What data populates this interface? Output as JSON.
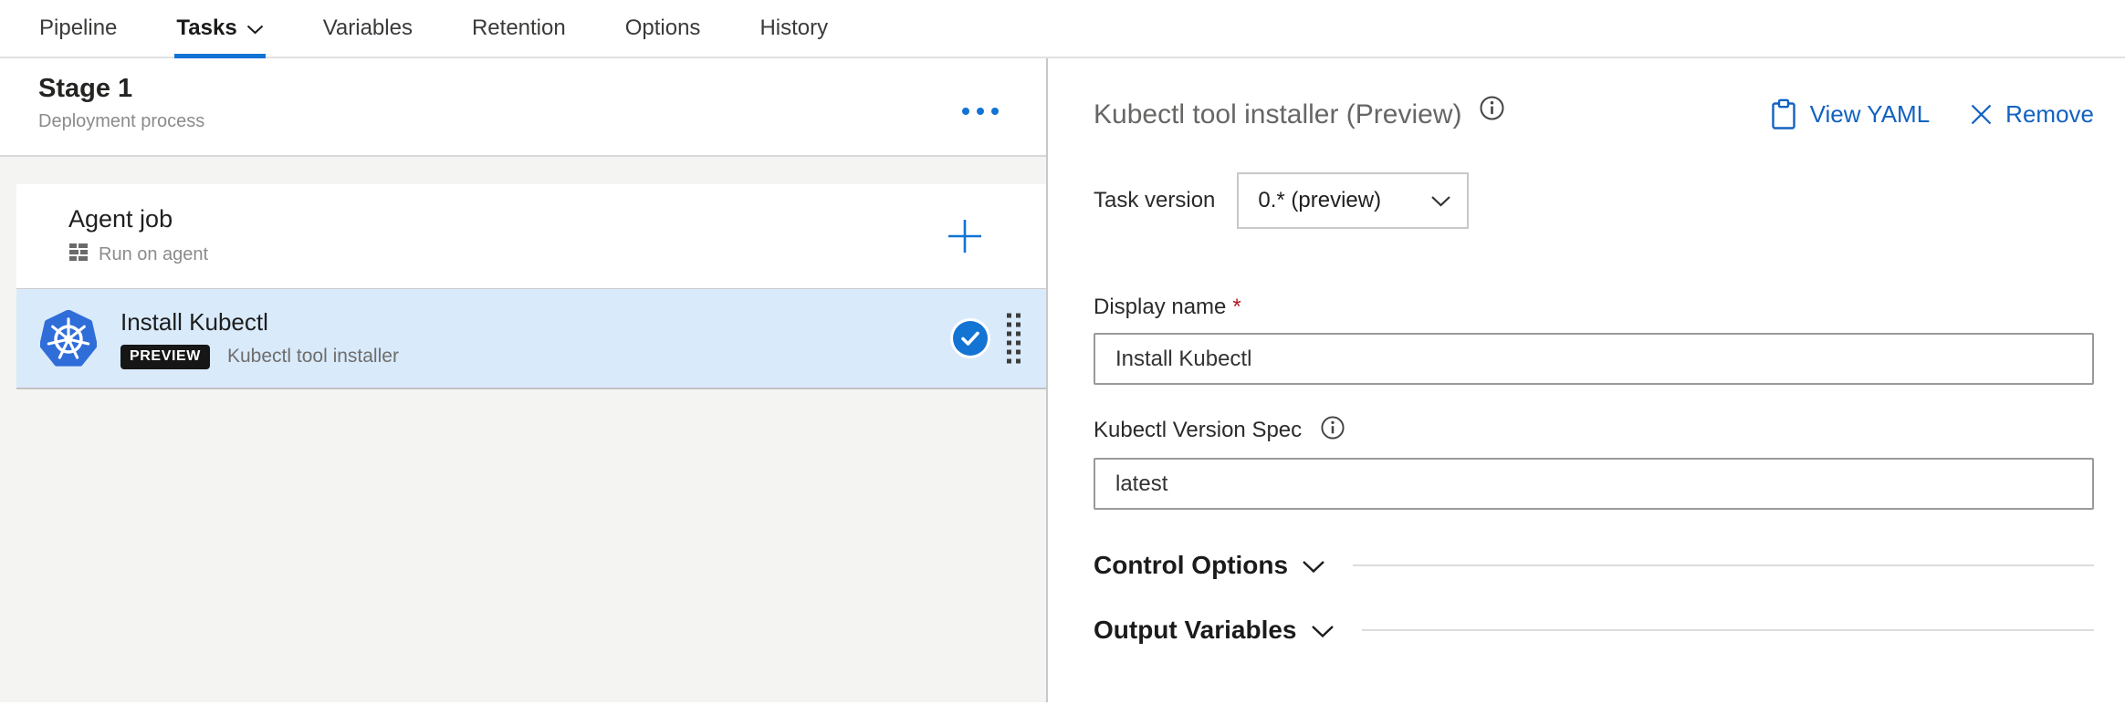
{
  "nav": {
    "items": [
      {
        "label": "Pipeline"
      },
      {
        "label": "Tasks",
        "selected": true
      },
      {
        "label": "Variables"
      },
      {
        "label": "Retention"
      },
      {
        "label": "Options"
      },
      {
        "label": "History"
      }
    ]
  },
  "stage_panel": {
    "title": "Stage 1",
    "subtitle": "Deployment process",
    "agent_job": {
      "title": "Agent job",
      "subtitle": "Run on agent"
    },
    "task": {
      "title": "Install Kubectl",
      "badge": "PREVIEW",
      "subtitle": "Kubectl tool installer"
    }
  },
  "detail_panel": {
    "title": "Kubectl tool installer (Preview)",
    "actions": {
      "view_yaml": "View YAML",
      "remove": "Remove"
    },
    "task_version": {
      "label": "Task version",
      "value": "0.* (preview)"
    },
    "display_name": {
      "label": "Display name",
      "required_marker": "*",
      "value": "Install Kubectl"
    },
    "version_spec": {
      "label": "Kubectl Version Spec",
      "value": "latest"
    },
    "sections": {
      "control_options": "Control Options",
      "output_variables": "Output Variables"
    }
  },
  "colors": {
    "accent_blue": "#1173d4",
    "link_blue": "#1262c1",
    "selection_bg": "#d9eafb",
    "badge_bg": "#161616",
    "badge_text": "#ffffff",
    "kubernetes_blue": "#2f6dd9",
    "required_red": "#b21521",
    "panel_gray": "#f4f4f2"
  }
}
